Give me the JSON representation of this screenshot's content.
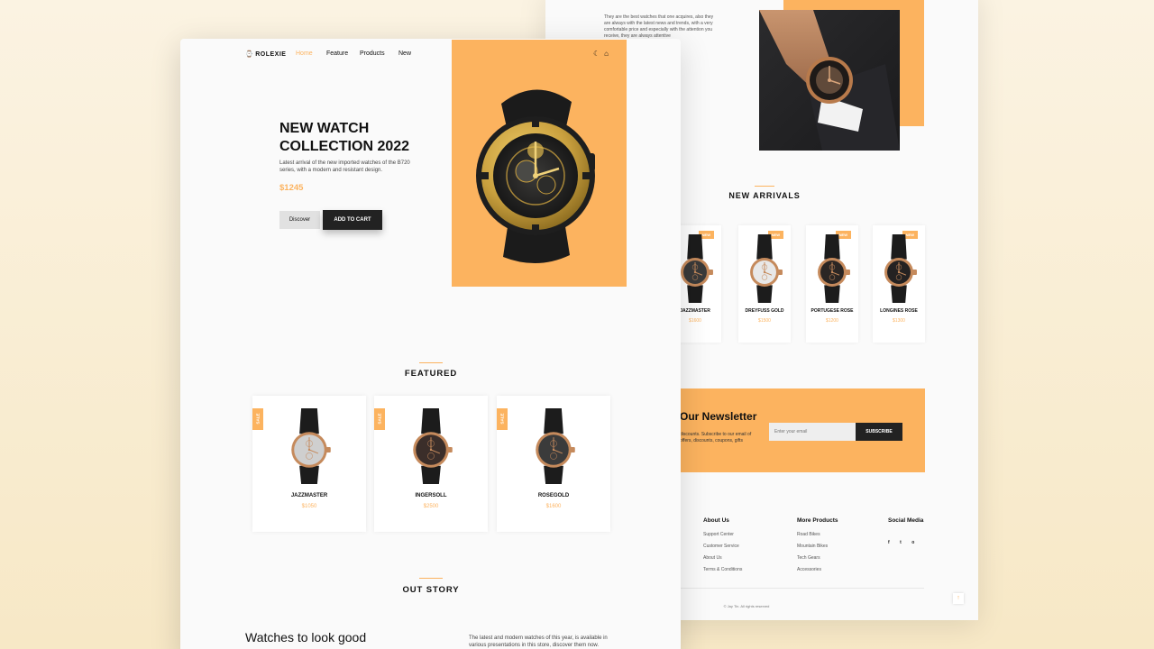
{
  "back_page": {
    "about_text": "They are the best watches that one acquires, also they are always with the latest news and trends, with a very comfortable price and especially with the attention you receive, they are always attentive",
    "partial_text": "ry",
    "new_arrivals": {
      "title": "NEW ARRIVALS",
      "items": [
        {
          "badge": "NEW",
          "name": "JAZZMASTER",
          "price": "$1600",
          "dial": "#3a3a3a"
        },
        {
          "badge": "NEW",
          "name": "DREYFUSS GOLD",
          "price": "$1500",
          "dial": "#e8e8e8"
        },
        {
          "badge": "NEW",
          "name": "PORTUGESE ROSE",
          "price": "$1200",
          "dial": "#2b2624"
        },
        {
          "badge": "NEW",
          "name": "LONGINES ROSE",
          "price": "$1300",
          "dial": "#242222"
        }
      ]
    },
    "newsletter": {
      "title": "Our Newsletter",
      "text": "discounts. Subscribe to our email of offers, discounts, coupons, gifts",
      "input_placeholder": "Enter your email",
      "button": "SUBSCRIBE"
    },
    "footer": {
      "about": {
        "title": "About Us",
        "links": [
          "Support Center",
          "Customer Service",
          "About Us",
          "Terms & Conditions"
        ]
      },
      "more": {
        "title": "More Products",
        "links": [
          "Road Bikes",
          "Mountain Bikes",
          "Tech Gears",
          "Accessories"
        ]
      },
      "social": {
        "title": "Social Media",
        "icons": [
          "facebook-icon",
          "twitter-icon",
          "instagram-icon"
        ],
        "glyphs": [
          "f",
          "t",
          "o"
        ]
      },
      "copyright": "© Jay Tin. All rights reserved",
      "scroll_top_glyph": "↑"
    }
  },
  "front_page": {
    "logo": {
      "icon": "⌚",
      "text": "ROLEXIE"
    },
    "nav": [
      {
        "label": "Home",
        "active": true
      },
      {
        "label": "Feature",
        "active": false
      },
      {
        "label": "Products",
        "active": false
      },
      {
        "label": "New",
        "active": false
      }
    ],
    "header_icons": {
      "theme": "☾",
      "cart": "⌂"
    },
    "hero": {
      "title_line1": "NEW WATCH",
      "title_line2": "COLLECTION 2022",
      "description": "Latest arrival of the new imported watches of the B720 series, with a modern and resistant design.",
      "price": "$1245",
      "discover_button": "Discover",
      "cart_button": "ADD TO CART"
    },
    "featured": {
      "title": "FEATURED",
      "items": [
        {
          "badge": "SALE",
          "name": "JAZZMASTER",
          "price": "$1050",
          "dial": "#cfcfcf"
        },
        {
          "badge": "SALE",
          "name": "INGERSOLL",
          "price": "$2500",
          "dial": "#3b2e2a"
        },
        {
          "badge": "SALE",
          "name": "ROSEGOLD",
          "price": "$1600",
          "dial": "#3b3b3b"
        }
      ]
    },
    "story": {
      "title": "OUT STORY",
      "heading": "Watches to look good",
      "text": "The latest and modern watches of this year, is available in various presentations in this store, discover them now."
    }
  },
  "colors": {
    "accent": "#fcb35f",
    "dark": "#222222"
  }
}
